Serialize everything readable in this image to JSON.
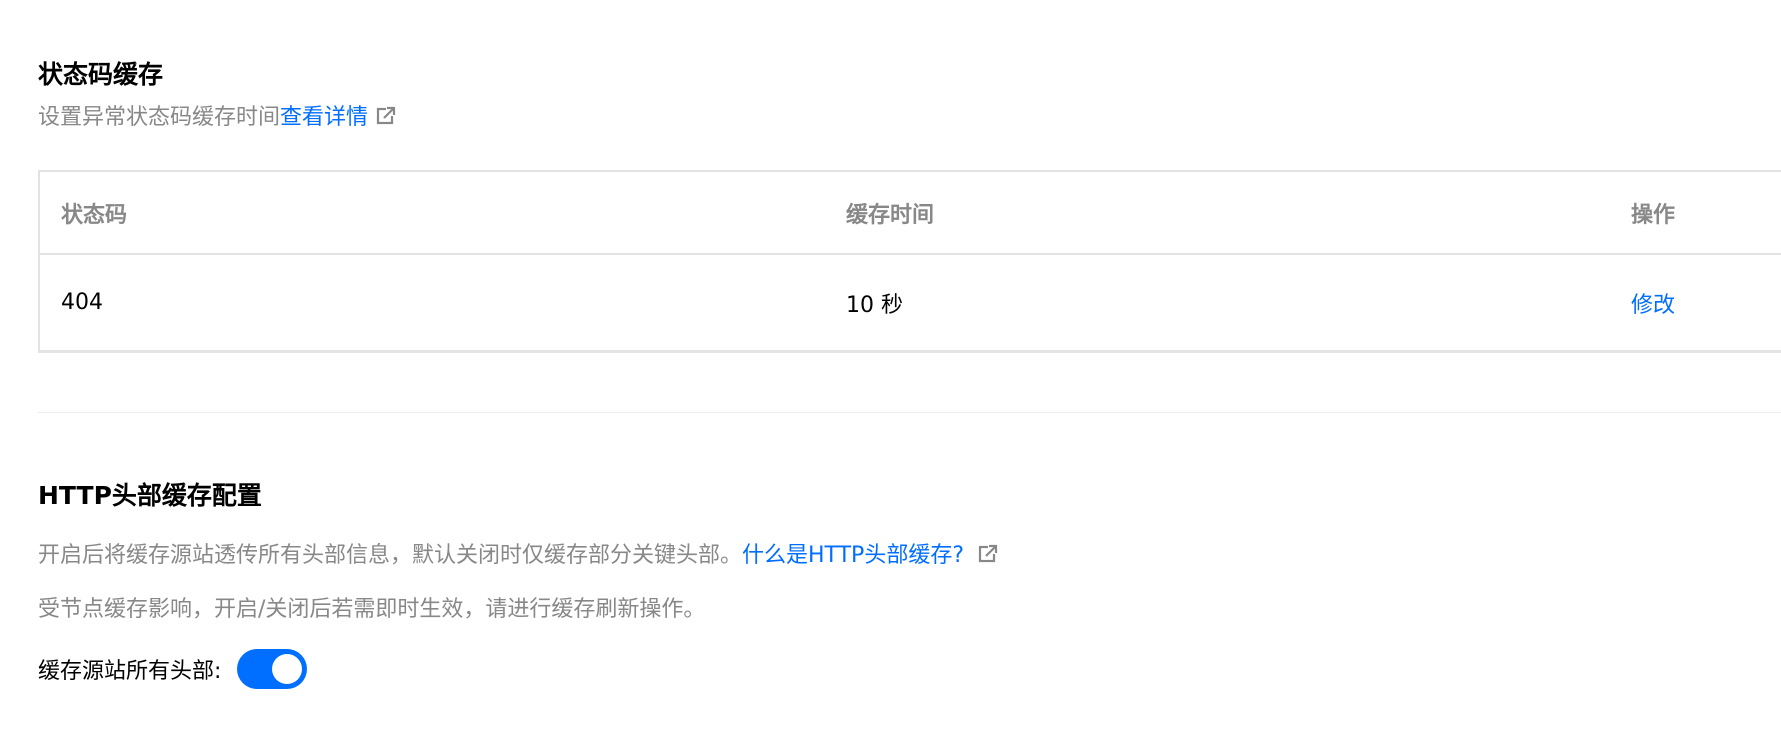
{
  "status_code_section": {
    "title": "状态码缓存",
    "description": "设置异常状态码缓存时间",
    "details_link": "查看详情",
    "external_icon": "external-link-icon",
    "table": {
      "headers": [
        "状态码",
        "缓存时间",
        "操作"
      ],
      "rows": [
        {
          "status_code": "404",
          "cache_time": "10 秒",
          "action": "修改"
        }
      ]
    }
  },
  "http_header_section": {
    "title": "HTTP头部缓存配置",
    "description_1": "开启后将缓存源站透传所有头部信息，默认关闭时仅缓存部分关键头部。",
    "help_link": "什么是HTTP头部缓存?",
    "external_icon": "external-link-icon",
    "description_2": "受节点缓存影响，开启/关闭后若需即时生效，请进行缓存刷新操作。",
    "toggle_label": "缓存源站所有头部:",
    "toggle_on": true
  },
  "colors": {
    "accent": "#006eff",
    "muted_text": "#888888",
    "border": "#e3e3e3"
  }
}
